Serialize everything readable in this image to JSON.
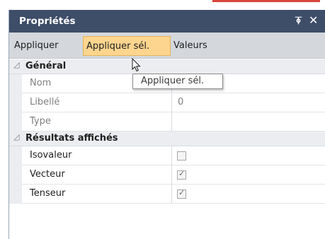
{
  "panel": {
    "title": "Propriétés",
    "pin_icon": "pin-icon",
    "close_icon": "close-icon",
    "pin_glyph": "ꟸ",
    "close_glyph": "✕"
  },
  "toolbar": {
    "apply_label": "Appliquer",
    "apply_selected_label": "Appliquer sél.",
    "values_label": "Valeurs"
  },
  "tooltip": "Appliquer sél.",
  "categories": [
    {
      "label": "Général",
      "expanded": true,
      "rows": [
        {
          "name": "Nom",
          "value": "0"
        },
        {
          "name": "Libellé",
          "value": "0"
        },
        {
          "name": "Type",
          "value": ""
        }
      ]
    },
    {
      "label": "Résultats affichés",
      "expanded": true,
      "rows": [
        {
          "name": "Isovaleur",
          "checked": false
        },
        {
          "name": "Vecteur",
          "checked": true
        },
        {
          "name": "Tenseur",
          "checked": true
        }
      ]
    }
  ],
  "colors": {
    "title_bar": "#3e4d68",
    "toolbar": "#d4d8dd",
    "highlight_button": "#fdd58f"
  }
}
